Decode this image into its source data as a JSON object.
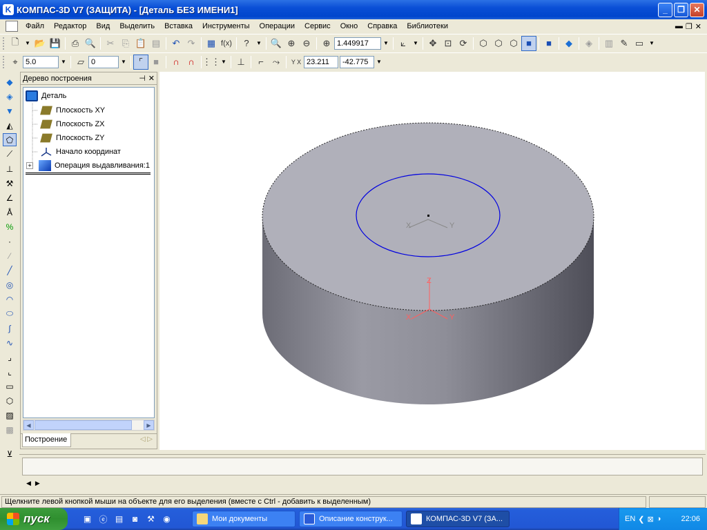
{
  "window": {
    "title": "КОМПАС-3D V7 (ЗАЩИТА) - [Деталь БЕЗ ИМЕНИ1]",
    "app_icon": "kompas-logo-icon"
  },
  "menu": {
    "items": [
      "Файл",
      "Редактор",
      "Вид",
      "Выделить",
      "Вставка",
      "Инструменты",
      "Операции",
      "Сервис",
      "Окно",
      "Справка",
      "Библиотеки"
    ]
  },
  "toolbar": {
    "zoom_value": "1.449917"
  },
  "toolbar2": {
    "step_value": "5.0",
    "layer_value": "0",
    "coord_x": "23.211",
    "coord_y": "-42.775",
    "coord_label": "Y X"
  },
  "panel": {
    "title": "Дерево построения",
    "tree": [
      {
        "label": "Деталь",
        "icon": "part-icon"
      },
      {
        "label": "Плоскость XY",
        "icon": "plane-icon"
      },
      {
        "label": "Плоскость ZX",
        "icon": "plane-icon"
      },
      {
        "label": "Плоскость ZY",
        "icon": "plane-icon"
      },
      {
        "label": "Начало координат",
        "icon": "origin-icon"
      },
      {
        "label": "Операция выдавливания:1",
        "icon": "extrusion-icon",
        "expand": "+"
      }
    ],
    "tab_label": "Построение"
  },
  "viewport": {
    "axis_labels": {
      "x": "X",
      "y": "Y",
      "z": "Z"
    },
    "colors": {
      "body_top": "#b0b0ba",
      "sketch_circle": "#0000e0",
      "axis": "#ff6060"
    }
  },
  "status": {
    "message": "Щелкните левой кнопкой мыши на объекте для его выделения (вместе с Ctrl - добавить к выделенным)"
  },
  "taskbar": {
    "start_label": "пуск",
    "tasks": [
      "Мои документы",
      "Описание конструк...",
      "КОМПАС-3D V7 (ЗА..."
    ],
    "lang": "EN",
    "clock": "22:06"
  }
}
